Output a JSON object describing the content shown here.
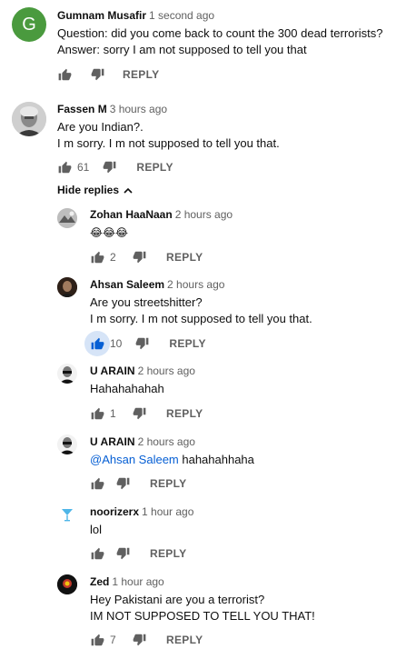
{
  "reply_label": "REPLY",
  "hide_replies_label": "Hide replies",
  "colors": {
    "liked_bg": "#d6e4f7",
    "liked_icon": "#065fd4",
    "icon_gray": "#606060",
    "mention": "#065fd4",
    "avatar_g": "#4a9a3e"
  },
  "comments": [
    {
      "author": "Gumnam Musafir",
      "time": "1 second ago",
      "avatar_letter": "G",
      "lines": [
        "Question:  did you come back to count the 300 dead terrorists?",
        "Answer: sorry I am not supposed to tell you that"
      ],
      "likes": ""
    },
    {
      "author": "Fassen M",
      "time": "3 hours ago",
      "lines": [
        "Are you Indian?.",
        "I m sorry. I m not supposed to tell you that."
      ],
      "likes": "61"
    }
  ],
  "replies": [
    {
      "author": "Zohan HaaNaan",
      "time": "2 hours ago",
      "lines": [
        "😂😂😂"
      ],
      "likes": "2"
    },
    {
      "author": "Ahsan Saleem",
      "time": "2 hours ago",
      "lines": [
        "Are you streetshitter?",
        "I m  sorry. I m not supposed to tell you that."
      ],
      "likes": "10",
      "liked": true
    },
    {
      "author": "U ARAIN",
      "time": "2 hours ago",
      "lines": [
        "Hahahahahah"
      ],
      "likes": "1"
    },
    {
      "author": "U ARAIN",
      "time": "2 hours ago",
      "mention": "@Ahsan Saleem",
      "after_mention": " hahahahhaha",
      "likes": ""
    },
    {
      "author": "noorizerx",
      "time": "1 hour ago",
      "lines": [
        "lol"
      ],
      "likes": ""
    },
    {
      "author": "Zed",
      "time": "1 hour ago",
      "lines": [
        "Hey Pakistani are you a terrorist?",
        "IM NOT SUPPOSED TO TELL YOU THAT!"
      ],
      "likes": "7"
    }
  ]
}
